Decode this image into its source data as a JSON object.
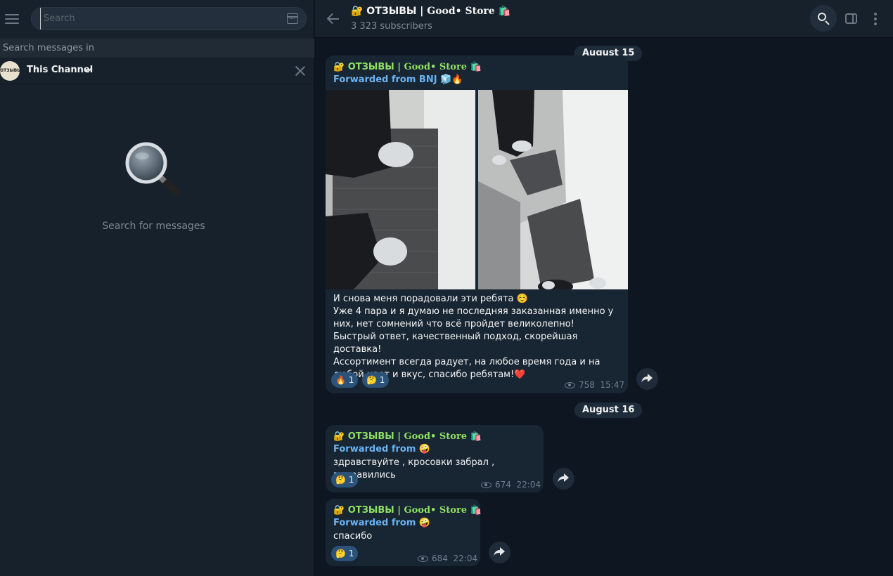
{
  "sidebar": {
    "search_placeholder": "Search",
    "search_in_label": "Search messages in",
    "channel_scope": "This Channel",
    "channel_avatar_text": "ОТЗЫВЫ",
    "empty_text": "Search for messages"
  },
  "header": {
    "title_prefix": "🔐 ОТЗЫВЫ | ",
    "title_brand": "Good• Store",
    "title_suffix": " 🛍️",
    "subscribers": "3 323 subscribers"
  },
  "messages": [
    {
      "date": "August 15",
      "author_prefix": "🔐 ОТЗЫВЫ | ",
      "author_brand": "Good• Store",
      "author_suffix": " 🛍️",
      "forwarded": "Forwarded from BNJ 🧊🔥",
      "text": "И снова меня порадовали эти ребята ☺️\nУже 4 пара и я думаю не последняя заказанная именно у них, нет сомнений что всё пройдет великолепно!\nБыстрый ответ, качественный подход, скорейшая доставка!\nАссортимент всегда радует, на любое время года и на любой цвет и вкус, спасибо ребятам!❤️",
      "reactions": [
        {
          "emoji": "🔥",
          "count": "1"
        },
        {
          "emoji": "🤔",
          "count": "1"
        }
      ],
      "views": "758",
      "time": "15:47"
    },
    {
      "date": "August 16",
      "author_prefix": "🔐 ОТЗЫВЫ | ",
      "author_brand": "Good• Store",
      "author_suffix": " 🛍️",
      "forwarded": "Forwarded from 🤪",
      "text": "здравствуйте , кросовки забрал , понравились",
      "reactions": [
        {
          "emoji": "🤔",
          "count": "1"
        }
      ],
      "views": "674",
      "time": "22:04"
    },
    {
      "author_prefix": "🔐 ОТЗЫВЫ | ",
      "author_brand": "Good• Store",
      "author_suffix": " 🛍️",
      "forwarded": "Forwarded from 🤪",
      "text": "спасибо",
      "reactions": [
        {
          "emoji": "🤔",
          "count": "1"
        }
      ],
      "views": "684",
      "time": "22:04"
    }
  ],
  "colors": {
    "bg_dark": "#0e1621",
    "panel": "#17212b",
    "bubble": "#182533",
    "author_green": "#8fe064",
    "link_blue": "#6ab3f3",
    "reaction_bg": "#2b5278"
  }
}
